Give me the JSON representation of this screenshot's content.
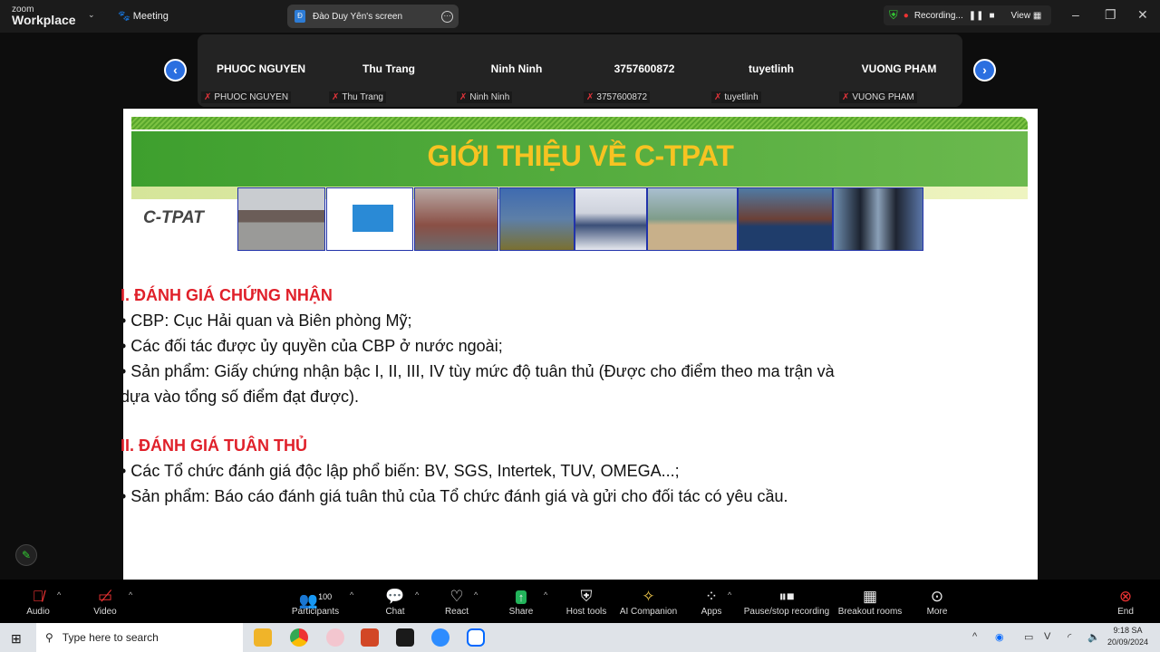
{
  "app": {
    "logo_small": "zoom",
    "logo_big": "Workplace",
    "meeting_label": "Meeting",
    "share_title": "Đào Duy Yên's screen",
    "share_initial": "Đ",
    "recording_label": "Recording...",
    "view_label": "View"
  },
  "participants": [
    {
      "name": "PHUOC NGUYEN"
    },
    {
      "name": "Thu Trang"
    },
    {
      "name": "Ninh Ninh"
    },
    {
      "name": "3757600872"
    },
    {
      "name": "tuyetlinh"
    },
    {
      "name": "VUONG PHAM"
    }
  ],
  "slide": {
    "title": "GIỚI THIỆU VỀ C-TPAT",
    "logo_text": "C-TPAT",
    "sections": [
      {
        "heading": "I. ĐÁNH GIÁ CHỨNG NHẬN",
        "bullets": [
          "• CBP: Cục Hải quan và Biên phòng Mỹ;",
          "• Các đối tác được ủy quyền của CBP ở nước ngoài;",
          "• Sản phẩm: Giấy chứng nhận bậc I, II, III, IV tùy mức độ tuân thủ (Được cho điểm theo ma trận và dựa vào tổng số điểm đạt được)."
        ]
      },
      {
        "heading": "II. ĐÁNH GIÁ TUÂN THỦ",
        "bullets": [
          "• Các Tổ chức đánh giá độc lập phổ biến: BV, SGS, Intertek, TUV, OMEGA...;",
          "• Sản phẩm: Báo cáo đánh giá tuân thủ của Tổ chức đánh giá và gửi cho đối tác có yêu cầu."
        ]
      }
    ]
  },
  "toolbar": {
    "audio": "Audio",
    "video": "Video",
    "participants": "Participants",
    "participants_count": "100",
    "chat": "Chat",
    "react": "React",
    "share": "Share",
    "host_tools": "Host tools",
    "ai_companion": "AI Companion",
    "apps": "Apps",
    "pause_stop": "Pause/stop recording",
    "breakout": "Breakout rooms",
    "more": "More",
    "end": "End"
  },
  "taskbar": {
    "search_placeholder": "Type here to search",
    "time": "9:18 SA",
    "date": "20/09/2024"
  },
  "colors": {
    "accent": "#2b6fe0",
    "slide_title": "#f7c322",
    "heading_red": "#e0202a",
    "end_red": "#e0333a"
  }
}
